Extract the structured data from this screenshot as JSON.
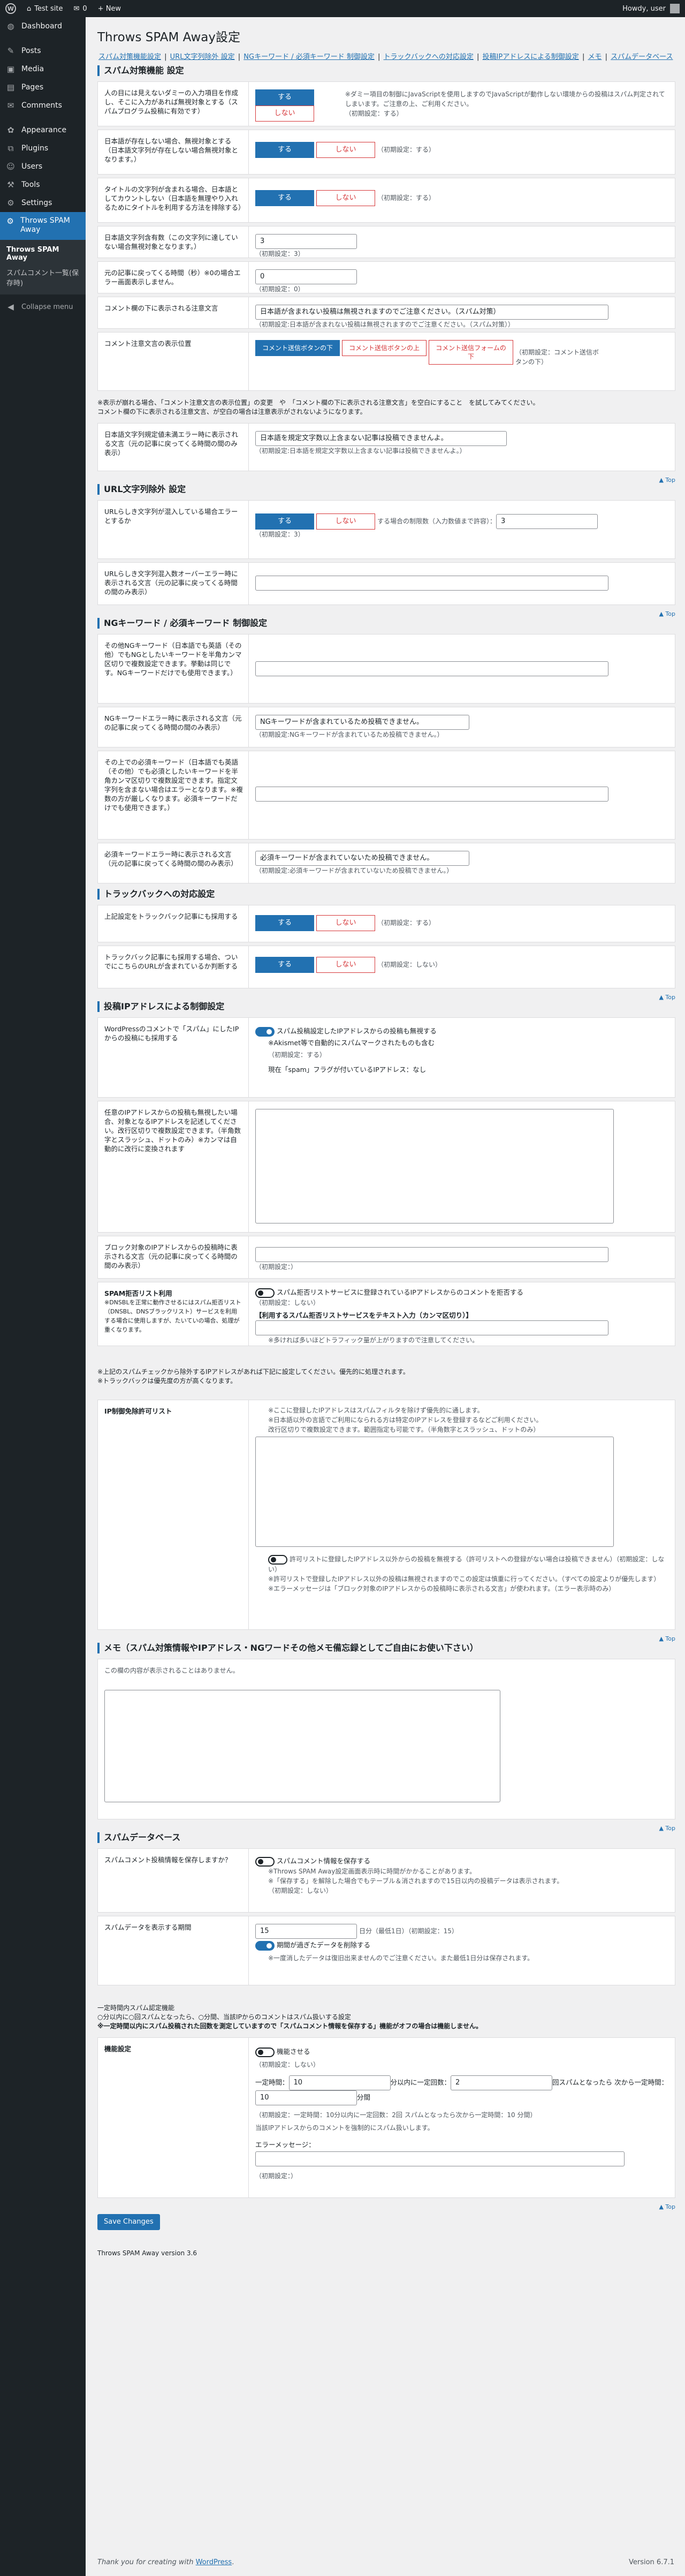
{
  "adminbar": {
    "site": "Test site",
    "comments": "0",
    "new": "+ New",
    "howdy": "Howdy, user"
  },
  "menu": [
    {
      "icon": "◍",
      "label": "Dashboard",
      "name": "dashboard"
    },
    {
      "sep": true
    },
    {
      "icon": "✎",
      "label": "Posts",
      "name": "posts"
    },
    {
      "icon": "▣",
      "label": "Media",
      "name": "media"
    },
    {
      "icon": "▤",
      "label": "Pages",
      "name": "pages"
    },
    {
      "icon": "✉",
      "label": "Comments",
      "name": "comments"
    },
    {
      "sep": true
    },
    {
      "icon": "✿",
      "label": "Appearance",
      "name": "appearance"
    },
    {
      "icon": "⧉",
      "label": "Plugins",
      "name": "plugins"
    },
    {
      "icon": "☺",
      "label": "Users",
      "name": "users"
    },
    {
      "icon": "⚒",
      "label": "Tools",
      "name": "tools"
    },
    {
      "icon": "⚙",
      "label": "Settings",
      "name": "settings"
    }
  ],
  "plugin_menu": {
    "label": "Throws SPAM Away",
    "sub1": "Throws SPAM Away",
    "sub2": "スパムコメント一覧(保存時)"
  },
  "collapse": "Collapse menu",
  "title": "Throws SPAM Away設定",
  "anchors": [
    "スパム対策機能設定",
    "URL文字列除外 設定",
    "NGキーワード / 必須キーワード 制御設定",
    "トラックバックへの対応設定",
    "投稿IPアドレスによる制御設定",
    "メモ",
    "スパムデータベース"
  ],
  "toplink": "▲ Top",
  "sec1": {
    "h": "スパム対策機能 設定",
    "r1": {
      "lbl": "人の目には見えないダミーの入力項目を作成し、そこに入力があれば無視対象とする（スパムプログラム投稿に有効です）",
      "yes": "する",
      "no": "しない",
      "note": "※ダミー項目の制御にJavaScriptを使用しますのでJavaScriptが動作しない環境からの投稿はスパム判定されてしまいます。ご注意の上、ご利用ください。",
      "def": "（初期設定：する）"
    },
    "r2": {
      "lbl": "日本語が存在しない場合、無視対象とする（日本語文字列が存在しない場合無視対象となります。）",
      "yes": "する",
      "no": "しない",
      "def": "（初期設定：する）"
    },
    "r3": {
      "lbl": "タイトルの文字列が含まれる場合、日本語としてカウントしない（日本語を無理やり入れるためにタイトルを利用する方法を排除する）",
      "yes": "する",
      "no": "しない",
      "def": "（初期設定：する）"
    },
    "r4": {
      "lbl": "日本語文字列含有数（この文字列に達していない場合無視対象となります。）",
      "val": "3",
      "def": "（初期設定：3）"
    },
    "r5": {
      "lbl": "元の記事に戻ってくる時間（秒）※0の場合エラー画面表示しません。",
      "val": "0",
      "def": "（初期設定：0）"
    },
    "r6": {
      "lbl": "コメント欄の下に表示される注意文言",
      "val": "日本語が含まれない投稿は無視されますのでご注意ください。（スパム対策）",
      "def": "（初期設定:日本語が含まれない投稿は無視されますのでご注意ください。（スパム対策））"
    },
    "r7": {
      "lbl": "コメント注意文言の表示位置",
      "b1": "コメント送信ボタンの下",
      "b2": "コメント送信ボタンの上",
      "b3": "コメント送信フォームの下",
      "def": "（初期設定：コメント送信ボタンの下）"
    },
    "warn1": "※表示が崩れる場合、「コメント注意文言の表示位置」の変更　や　「コメント欄の下に表示される注意文言」を空白にすること　を試してみてください。",
    "warn2": "コメント欄の下に表示される注意文言、が空白の場合は注意表示がされないようになります。",
    "r8": {
      "lbl": "日本語文字列規定値未満エラー時に表示される文言（元の記事に戻ってくる時間の間のみ表示）",
      "val": "日本語を規定文字数以上含まない記事は投稿できませんよ。",
      "def": "（初期設定:日本語を規定文字数以上含まない記事は投稿できませんよ。）"
    }
  },
  "sec2": {
    "h": "URL文字列除外 設定",
    "r1": {
      "lbl": "URLらしき文字列が混入している場合エラーとするか",
      "yes": "する",
      "no": "しない",
      "mid": "する場合の制限数（入力数値まで許容）：",
      "val": "3",
      "def": "（初期設定：3）"
    },
    "r2": {
      "lbl": "URLらしき文字列混入数オーバーエラー時に表示される文言（元の記事に戻ってくる時間の間のみ表示）",
      "val": ""
    }
  },
  "sec3": {
    "h": "NGキーワード / 必須キーワード 制御設定",
    "r1": {
      "lbl": "その他NGキーワード（日本語でも英語（その他）でもNGとしたいキーワードを半角カンマ区切りで複数設定できます。挙動は同じです。NGキーワードだけでも使用できます。）",
      "val": ""
    },
    "r2": {
      "lbl": "NGキーワードエラー時に表示される文言（元の記事に戻ってくる時間の間のみ表示）",
      "val": "NGキーワードが含まれているため投稿できません。",
      "def": "（初期設定:NGキーワードが含まれているため投稿できません。）"
    },
    "r3": {
      "lbl": "その上での必須キーワード（日本語でも英語（その他）でも必須としたいキーワードを半角カンマ区切りで複数設定できます。指定文字列を含まない場合はエラーとなります。※複数の方が厳しくなります。必須キーワードだけでも使用できます。）",
      "val": ""
    },
    "r4": {
      "lbl": "必須キーワードエラー時に表示される文言（元の記事に戻ってくる時間の間のみ表示）",
      "val": "必須キーワードが含まれていないため投稿できません。",
      "def": "（初期設定:必須キーワードが含まれていないため投稿できません。）"
    }
  },
  "sec4": {
    "h": "トラックバックへの対応設定",
    "r1": {
      "lbl": "上記設定をトラックバック記事にも採用する",
      "yes": "する",
      "no": "しない",
      "def": "（初期設定：する）"
    },
    "r2": {
      "lbl": "トラックバック記事にも採用する場合、ついでにこちらのURLが含まれているか判断する",
      "yes": "する",
      "no": "しない",
      "def": "（初期設定：しない）"
    }
  },
  "sec5": {
    "h": "投稿IPアドレスによる制御設定",
    "r1": {
      "lbl": "WordPressのコメントで「スパム」にしたIPからの投稿にも採用する",
      "t1": "スパム投稿設定したIPアドレスからの投稿も無視する",
      "t2": "※Akismet等で自動的にスパムマークされたものも含む",
      "def": "（初期設定：する）",
      "cur": "現在「spam」フラグが付いているIPアドレス：なし"
    },
    "r2": {
      "lbl": "任意のIPアドレスからの投稿も無視したい場合、対象となるIPアドレスを記述してください。改行区切りで複数設定できます。（半角数字とスラッシュ、ドットのみ）※カンマは自動的に改行に変換されます"
    },
    "r3": {
      "lbl": "ブロック対象のIPアドレスからの投稿時に表示される文言（元の記事に戻ってくる時間の間のみ表示）",
      "val": "",
      "def": "（初期設定：）"
    },
    "r4": {
      "lbl": "SPAM拒否リスト利用",
      "lbl2": "※DNSBLを正常に動作させるにはスパム拒否リスト（DNSBL、DNSブラックリスト）サービスを利用する場合に使用しますが、たいていの場合、処理が重くなります。",
      "t": "スパム拒否リストサービスに登録されているIPアドレスからのコメントを拒否する",
      "def": "（初期設定：しない）",
      "sub": "【利用するスパム拒否リストサービスをテキスト入力（カンマ区切り）】",
      "val": "",
      "warn": "※多ければ多いほどトラフィック量が上がりますので注意してください。"
    },
    "note1": "※上記のスパムチェックから除外するIPアドレスがあれば下記に設定してください。優先的に処理されます。",
    "note2": "※トラックバックは優先度の方が高くなります。",
    "r5": {
      "lbl": "IP制御免除許可リスト",
      "i1": "※ここに登録したIPアドレスはスパムフィルタを除けず優先的に通します。",
      "i2": "※日本語以外の言語でご利用になられる方は特定のIPアドレスを登録するなどご利用ください。",
      "i3": "改行区切りで複数設定できます。範囲指定も可能です。（半角数字とスラッシュ、ドットのみ）",
      "t": "許可リストに登録したIPアドレス以外からの投稿を無視する（許可リストへの登録がない場合は投稿できません）（初期設定：しない）",
      "w1": "※許可リストで登録したIPアドレス以外の投稿は無視されますのでこの設定は慎重に行ってください。（すべての設定よりが優先します）",
      "w2": "※エラーメッセージは「ブロック対象のIPアドレスからの投稿時に表示される文言」が使われます。（エラー表示時のみ）"
    }
  },
  "sec6": {
    "h": "メモ（スパム対策情報やIPアドレス・NGワードその他メモ備忘録としてご自由にお使い下さい）",
    "note": "この欄の内容が表示されることはありません。"
  },
  "sec7": {
    "h": "スパムデータベース",
    "r1": {
      "lbl": "スパムコメント投稿情報を保存しますか？",
      "t": "スパムコメント情報を保存する",
      "n1": "※Throws SPAM Away設定画面表示時に時間がかかることがあります。",
      "n2": "※「保存する」を解除した場合でもテーブル＆消されますので15日以内の投稿データは表示されます。",
      "def": "（初期設定：しない）"
    },
    "r2": {
      "lbl": "スパムデータを表示する期間",
      "val": "15",
      "unit": "日分（最低1日）（初期設定：15）",
      "t": "期間が過ぎたデータを削除する",
      "n": "※一度消したデータは復旧出来ませんのでご注意ください。また最低1日分は保存されます。"
    },
    "plain1": "一定時間内スパム認定機能",
    "plain2": "○分以内に○回スパムとなったら、○分間、当該IPからのコメントはスパム扱いする設定",
    "plain3": "※一定時間以内にスパム投稿された回数を測定していますので「スパムコメント情報を保存する」機能がオフの場合は機能しません。",
    "r3": {
      "lbl": "機能設定",
      "t": "機能させる",
      "def": "（初期設定：しない）",
      "p1": "一定時間：",
      "v1": "10",
      "p2": "分以内に一定回数：",
      "v2": "2",
      "p3": "回スパムとなったら 次から一定時間：",
      "v3": "10",
      "p4": "分間",
      "n1": "（初期設定：一定時間：10分以内に一定回数：2回 スパムとなったら次から一定時間：10 分間）",
      "n2": "当該IPアドレスからのコメントを強制的にスパム扱いします。",
      "err": "エラーメッセージ：",
      "errv": "",
      "def2": "（初期設定：）"
    }
  },
  "save": "Save Changes",
  "pver": "Throws SPAM Away version 3.6",
  "footer_pre": "Thank you for creating with ",
  "footer_link": "WordPress",
  "footer_post": ".",
  "wpver": "Version 6.7.1"
}
